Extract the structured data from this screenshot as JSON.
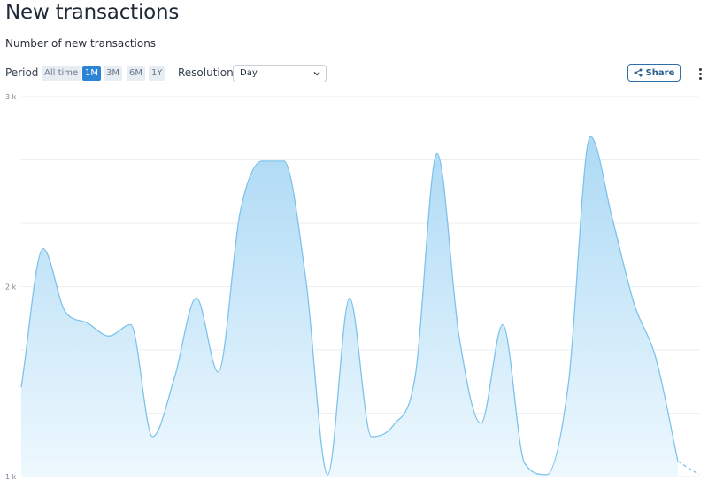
{
  "header": {
    "title": "New transactions",
    "subtitle": "Number of new transactions"
  },
  "toolbar": {
    "period_label": "Period",
    "period_options": [
      "All time",
      "1M",
      "3M",
      "6M",
      "1Y"
    ],
    "active_period": "1M",
    "resolution_label": "Resolution",
    "resolution_value": "Day",
    "share_label": "Share"
  },
  "icons": [
    "share-icon",
    "chevron-down-icon",
    "more-vertical-icon"
  ],
  "colors": {
    "accent": "#2d84d6",
    "line": "#7ec3ea",
    "fill_top": "#a5d6f4",
    "fill_bottom": "#eef8fe"
  },
  "chart_data": {
    "type": "area",
    "title": "",
    "xlabel": "",
    "ylabel": "",
    "ylim": [
      1000,
      3000
    ],
    "yticks": [
      1000,
      2000,
      3000
    ],
    "ytick_labels": [
      "1 k",
      "2 k",
      "3 k"
    ],
    "grid": true,
    "series": [
      {
        "values": [
          1470,
          2200,
          1870,
          1810,
          1740,
          1800,
          1210,
          1520,
          1940,
          1550,
          2390,
          2660,
          2660,
          2040,
          1010,
          1940,
          1210,
          1270,
          1530,
          2700,
          1740,
          1280,
          1800,
          1070,
          1010,
          1490,
          2790,
          2360,
          1910,
          1620,
          1080
        ],
        "projected_end": 1010
      }
    ]
  }
}
